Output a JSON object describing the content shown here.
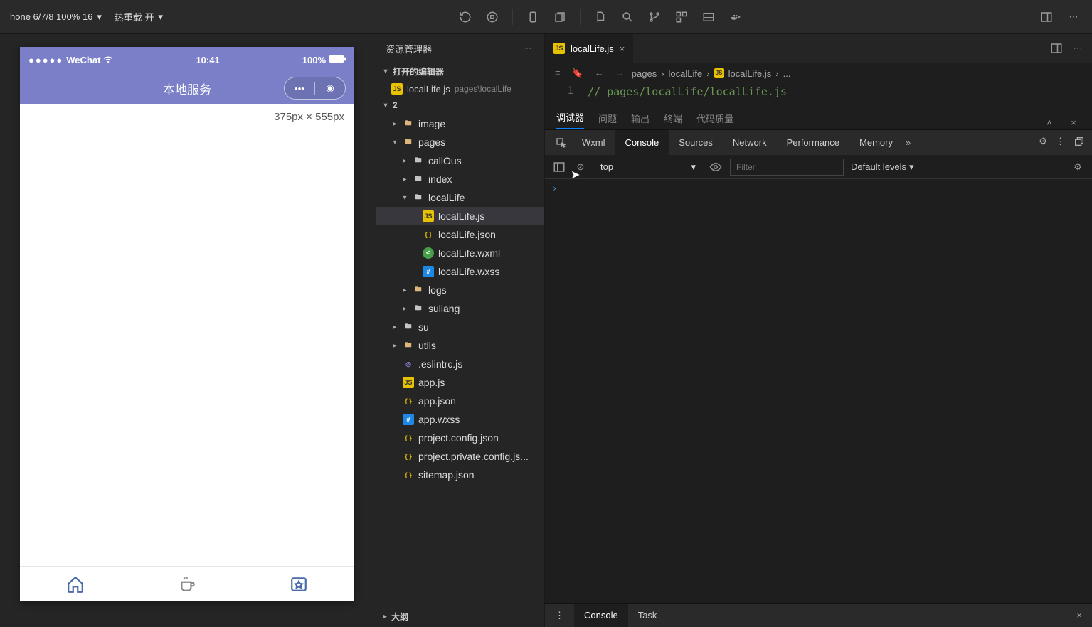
{
  "top": {
    "device": "hone 6/7/8 100% 16",
    "hot_reload": "热重载 开"
  },
  "simulator": {
    "carrier": "WeChat",
    "time": "10:41",
    "battery": "100%",
    "nav_title": "本地服务",
    "size_hint": "375px × 555px"
  },
  "explorer": {
    "title": "资源管理器",
    "open_editors": "打开的编辑器",
    "open_file": "localLife.js",
    "open_file_path": "pages\\localLife",
    "project": "2",
    "outline": "大纲",
    "tree": {
      "image": "image",
      "pages": "pages",
      "callOus": "callOus",
      "index": "index",
      "localLife": "localLife",
      "localLife_js": "localLife.js",
      "localLife_json": "localLife.json",
      "localLife_wxml": "localLife.wxml",
      "localLife_wxss": "localLife.wxss",
      "logs": "logs",
      "suliang": "suliang",
      "su": "su",
      "utils": "utils",
      "eslintrc": ".eslintrc.js",
      "app_js": "app.js",
      "app_json": "app.json",
      "app_wxss": "app.wxss",
      "proj_config": "project.config.json",
      "proj_private": "project.private.config.js...",
      "sitemap": "sitemap.json"
    }
  },
  "editor": {
    "tab": "localLife.js",
    "breadcrumb": [
      "pages",
      "localLife",
      "localLife.js",
      "..."
    ],
    "line_no": "1",
    "code_line": "// pages/localLife/localLife.js"
  },
  "lower_panel": {
    "tabs": [
      "调试器",
      "问题",
      "输出",
      "终端",
      "代码质量"
    ]
  },
  "devtools": {
    "tabs": [
      "Wxml",
      "Console",
      "Sources",
      "Network",
      "Performance",
      "Memory"
    ],
    "context": "top",
    "filter_placeholder": "Filter",
    "levels": "Default levels"
  },
  "status": {
    "console": "Console",
    "task": "Task"
  }
}
